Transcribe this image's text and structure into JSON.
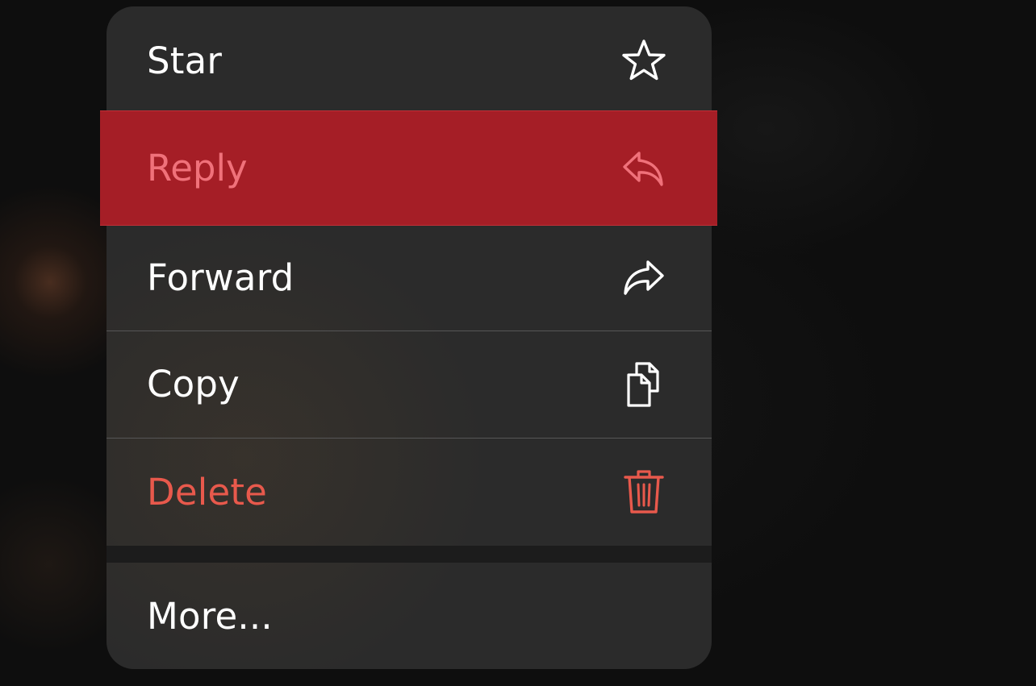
{
  "menu": {
    "items": [
      {
        "label": "Star",
        "icon": "star-icon"
      },
      {
        "label": "Reply",
        "icon": "reply-icon",
        "highlighted": true
      },
      {
        "label": "Forward",
        "icon": "forward-icon"
      },
      {
        "label": "Copy",
        "icon": "copy-icon"
      },
      {
        "label": "Delete",
        "icon": "trash-icon",
        "destructive": true
      },
      {
        "label": "More..."
      }
    ]
  },
  "colors": {
    "menu_background": "#2b2b2b",
    "text": "#ffffff",
    "destructive": "#e8594c",
    "highlight_overlay": "#a51e26",
    "highlight_text": "#f0717a",
    "separator": "#565656"
  }
}
